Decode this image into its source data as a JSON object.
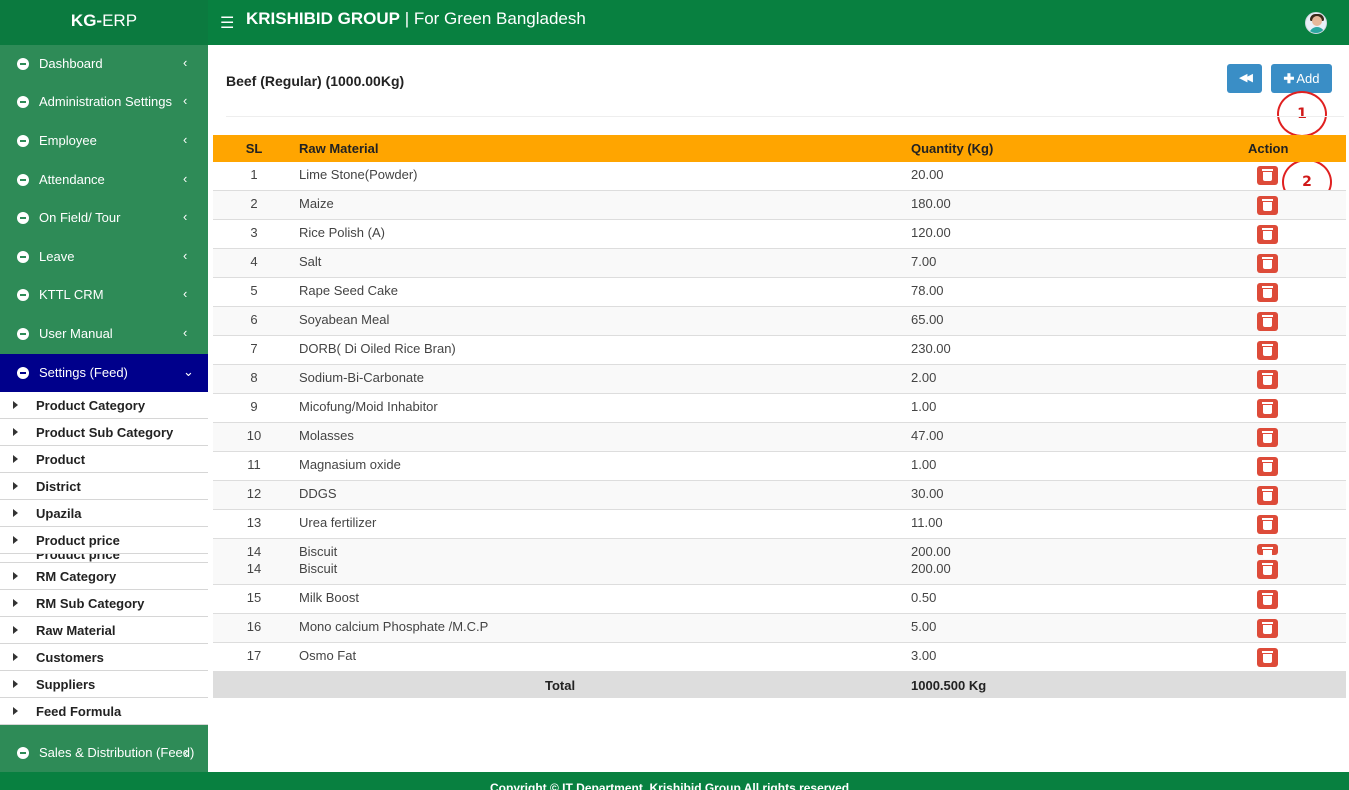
{
  "app": {
    "logo_prefix": "KG-",
    "logo_suffix": "ERP",
    "brand_bold": "KRISHIBID GROUP",
    "brand_rest": " | For Green Bangladesh",
    "menu_icon": "hamburger-icon",
    "avatar_icon": "user-avatar"
  },
  "colors": {
    "topbar": "#088040",
    "sidebar": "#2e8b57",
    "active_menu": "#00008b",
    "table_header": "#ffa500",
    "button": "#3a8ec6",
    "delete": "#dd4b39",
    "annotation": "#e02020"
  },
  "sidebar": {
    "menu": [
      {
        "label": "Dashboard",
        "chevron": "‹"
      },
      {
        "label": "Administration Settings",
        "chevron": "‹"
      },
      {
        "label": "Employee",
        "chevron": "‹"
      },
      {
        "label": "Attendance",
        "chevron": "‹"
      },
      {
        "label": "On Field/ Tour",
        "chevron": "‹"
      },
      {
        "label": "Leave",
        "chevron": "‹"
      },
      {
        "label": "KTTL CRM",
        "chevron": "‹"
      },
      {
        "label": "User Manual",
        "chevron": "‹"
      },
      {
        "label": "Settings (Feed)",
        "chevron": "⌄"
      }
    ],
    "submenu": [
      "Product Category",
      "Product Sub Category",
      "Product",
      "District",
      "Upazila",
      "Product price",
      "Product price",
      "RM Category",
      "RM Sub Category",
      "Raw Material",
      "Customers",
      "Suppliers",
      "Feed Formula"
    ],
    "sales": {
      "label": "Sales & Distribution (Feed)",
      "chevron": "‹"
    }
  },
  "main": {
    "title": "Beef (Regular) (1000.00Kg)",
    "back_icon": "fast-backward-icon",
    "back_glyph": "◀◀",
    "add_plus": "✚",
    "add_label": "Add",
    "annotations": [
      "1",
      "2"
    ]
  },
  "table": {
    "headers": {
      "sl": "SL",
      "raw_material": "Raw Material",
      "quantity": "Quantity (Kg)",
      "action": "Action"
    },
    "rows": [
      {
        "sl": "1",
        "name": "Lime Stone(Powder)",
        "qty": "20.00"
      },
      {
        "sl": "2",
        "name": "Maize",
        "qty": "180.00"
      },
      {
        "sl": "3",
        "name": "Rice Polish (A)",
        "qty": "120.00"
      },
      {
        "sl": "4",
        "name": "Salt",
        "qty": "7.00"
      },
      {
        "sl": "5",
        "name": "Rape Seed Cake",
        "qty": "78.00"
      },
      {
        "sl": "6",
        "name": "Soyabean Meal",
        "qty": "65.00"
      },
      {
        "sl": "7",
        "name": "DORB( Di Oiled Rice Bran)",
        "qty": "230.00"
      },
      {
        "sl": "8",
        "name": "Sodium-Bi-Carbonate",
        "qty": "2.00"
      },
      {
        "sl": "9",
        "name": "Micofung/Moid Inhabitor",
        "qty": "1.00"
      },
      {
        "sl": "10",
        "name": "Molasses",
        "qty": "47.00"
      },
      {
        "sl": "11",
        "name": "Magnasium oxide",
        "qty": "1.00"
      },
      {
        "sl": "12",
        "name": "DDGS",
        "qty": "30.00"
      },
      {
        "sl": "13",
        "name": "Urea fertilizer",
        "qty": "11.00"
      },
      {
        "sl": "14",
        "name": "Biscuit",
        "qty": "200.00",
        "dup_sl": "14",
        "dup_name": "Biscuit",
        "dup_qty": "200.00"
      },
      {
        "sl": "15",
        "name": "Milk Boost",
        "qty": "0.50"
      },
      {
        "sl": "16",
        "name": "Mono calcium Phosphate /M.C.P",
        "qty": "5.00"
      },
      {
        "sl": "17",
        "name": "Osmo Fat",
        "qty": "3.00"
      }
    ],
    "total_label": "Total",
    "total_value": "1000.500 Kg",
    "delete_icon": "trash-icon"
  },
  "footer": {
    "text": "Copyright © IT Department, Krishibid Group All rights reserved."
  }
}
